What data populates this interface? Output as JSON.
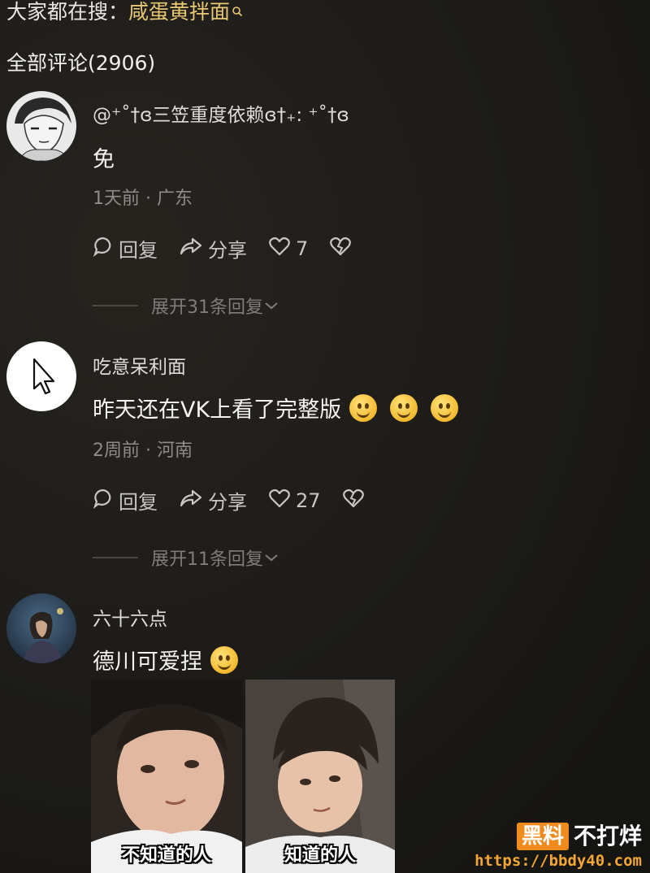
{
  "search": {
    "prefix": "大家都在搜：",
    "hot_term": "咸蛋黄拌面",
    "icon": "search-icon"
  },
  "comments_total": "全部评论(2906)",
  "comments": [
    {
      "username": "@⁺˚†ɞ三笠重度依赖ɞ†₊: ⁺˚†ɞ",
      "content": "免",
      "meta": "1天前 · 广东",
      "reply_label": "回复",
      "share_label": "分享",
      "likes": "7",
      "expand_label": "展开31条回复"
    },
    {
      "username": "吃意呆利面",
      "content": "昨天还在VK上看了完整版",
      "emoji_count": 3,
      "meta": "2周前 · 河南",
      "reply_label": "回复",
      "share_label": "分享",
      "likes": "27",
      "expand_label": "展开11条回复"
    },
    {
      "username": "六十六点",
      "content": "德川可爱捏",
      "emoji_count": 1,
      "meme_captions": [
        "不知道的人",
        "知道的人"
      ]
    }
  ],
  "watermark": {
    "badge": "黑料",
    "text": "不打烊",
    "url": "https://bbdy40.com"
  },
  "colors": {
    "background": "#1e1d1b",
    "hot_term": "#e8c873",
    "watermark_orange": "#f08a1c"
  }
}
